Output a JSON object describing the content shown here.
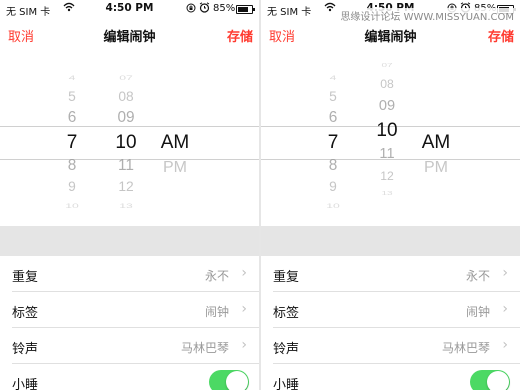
{
  "watermark": "思缘设计论坛 WWW.MISSYUAN.COM",
  "screens": [
    {
      "status": {
        "carrier": "无 SIM 卡",
        "time": "4:50 PM",
        "battery": "85%",
        "battery_level_pct": 85
      },
      "nav": {
        "cancel": "取消",
        "title": "编辑闹钟",
        "save": "存储"
      },
      "picker": {
        "hours": [
          "4",
          "5",
          "6",
          "7",
          "8",
          "9",
          "10"
        ],
        "hours_selected": 3,
        "minutes": [
          "07",
          "08",
          "09",
          "10",
          "11",
          "12",
          "13"
        ],
        "minutes_selected": 3,
        "ampm": [
          "AM",
          "PM"
        ],
        "ampm_selected": 0
      },
      "rows": [
        {
          "label": "重复",
          "value": "永不"
        },
        {
          "label": "标签",
          "value": "闹钟"
        },
        {
          "label": "铃声",
          "value": "马林巴琴"
        },
        {
          "label": "小睡",
          "toggle_on": true
        }
      ]
    },
    {
      "status": {
        "carrier": "无 SIM 卡",
        "time": "4:50 PM",
        "battery": "85%",
        "battery_level_pct": 85
      },
      "nav": {
        "cancel": "取消",
        "title": "编辑闹钟",
        "save": "存储"
      },
      "picker": {
        "hours": [
          "4",
          "5",
          "6",
          "7",
          "8",
          "9",
          "10"
        ],
        "hours_selected": 3,
        "minutes": [
          "07",
          "08",
          "09",
          "10",
          "11",
          "12",
          "13"
        ],
        "minutes_selected": 3,
        "ampm": [
          "AM",
          "PM"
        ],
        "ampm_selected": 0
      },
      "rows": [
        {
          "label": "重复",
          "value": "永不"
        },
        {
          "label": "标签",
          "value": "闹钟"
        },
        {
          "label": "铃声",
          "value": "马林巴琴"
        },
        {
          "label": "小睡",
          "toggle_on": true
        }
      ]
    }
  ],
  "icons": {
    "wifi": "wifi-icon",
    "lock": "rotation-lock-icon",
    "alarm": "alarm-clock-icon",
    "chevron": "chevron-right-icon"
  }
}
